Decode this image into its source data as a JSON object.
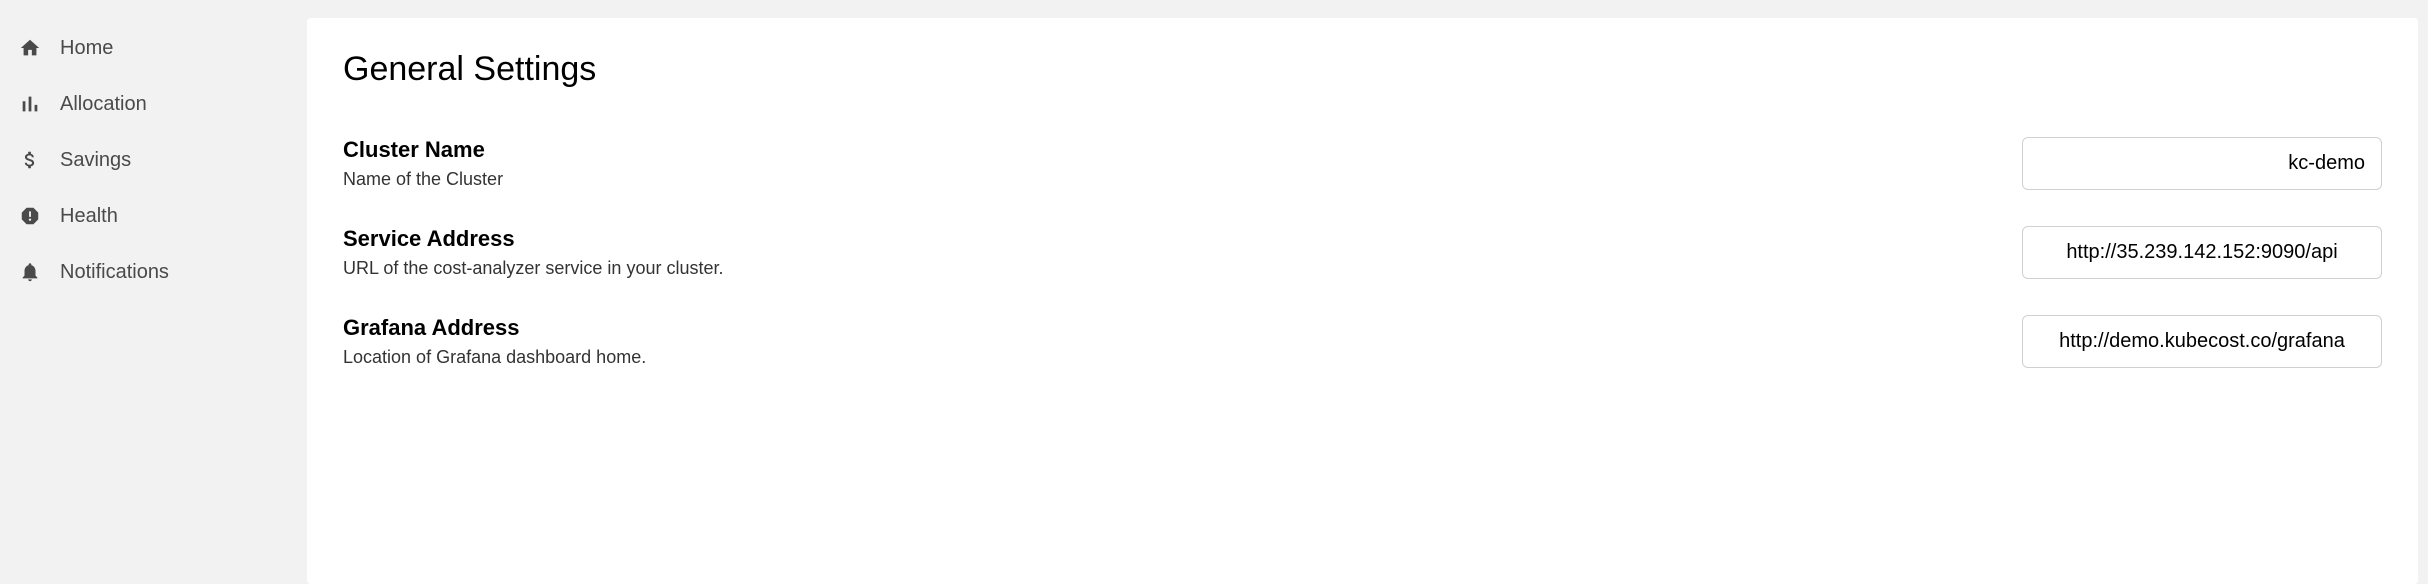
{
  "sidebar": {
    "items": [
      {
        "label": "Home"
      },
      {
        "label": "Allocation"
      },
      {
        "label": "Savings"
      },
      {
        "label": "Health"
      },
      {
        "label": "Notifications"
      }
    ]
  },
  "main": {
    "title": "General Settings",
    "settings": [
      {
        "label": "Cluster Name",
        "desc": "Name of the Cluster",
        "value": "kc-demo"
      },
      {
        "label": "Service Address",
        "desc": "URL of the cost-analyzer service in your cluster.",
        "value": "http://35.239.142.152:9090/api"
      },
      {
        "label": "Grafana Address",
        "desc": "Location of Grafana dashboard home.",
        "value": "http://demo.kubecost.co/grafana"
      }
    ]
  }
}
